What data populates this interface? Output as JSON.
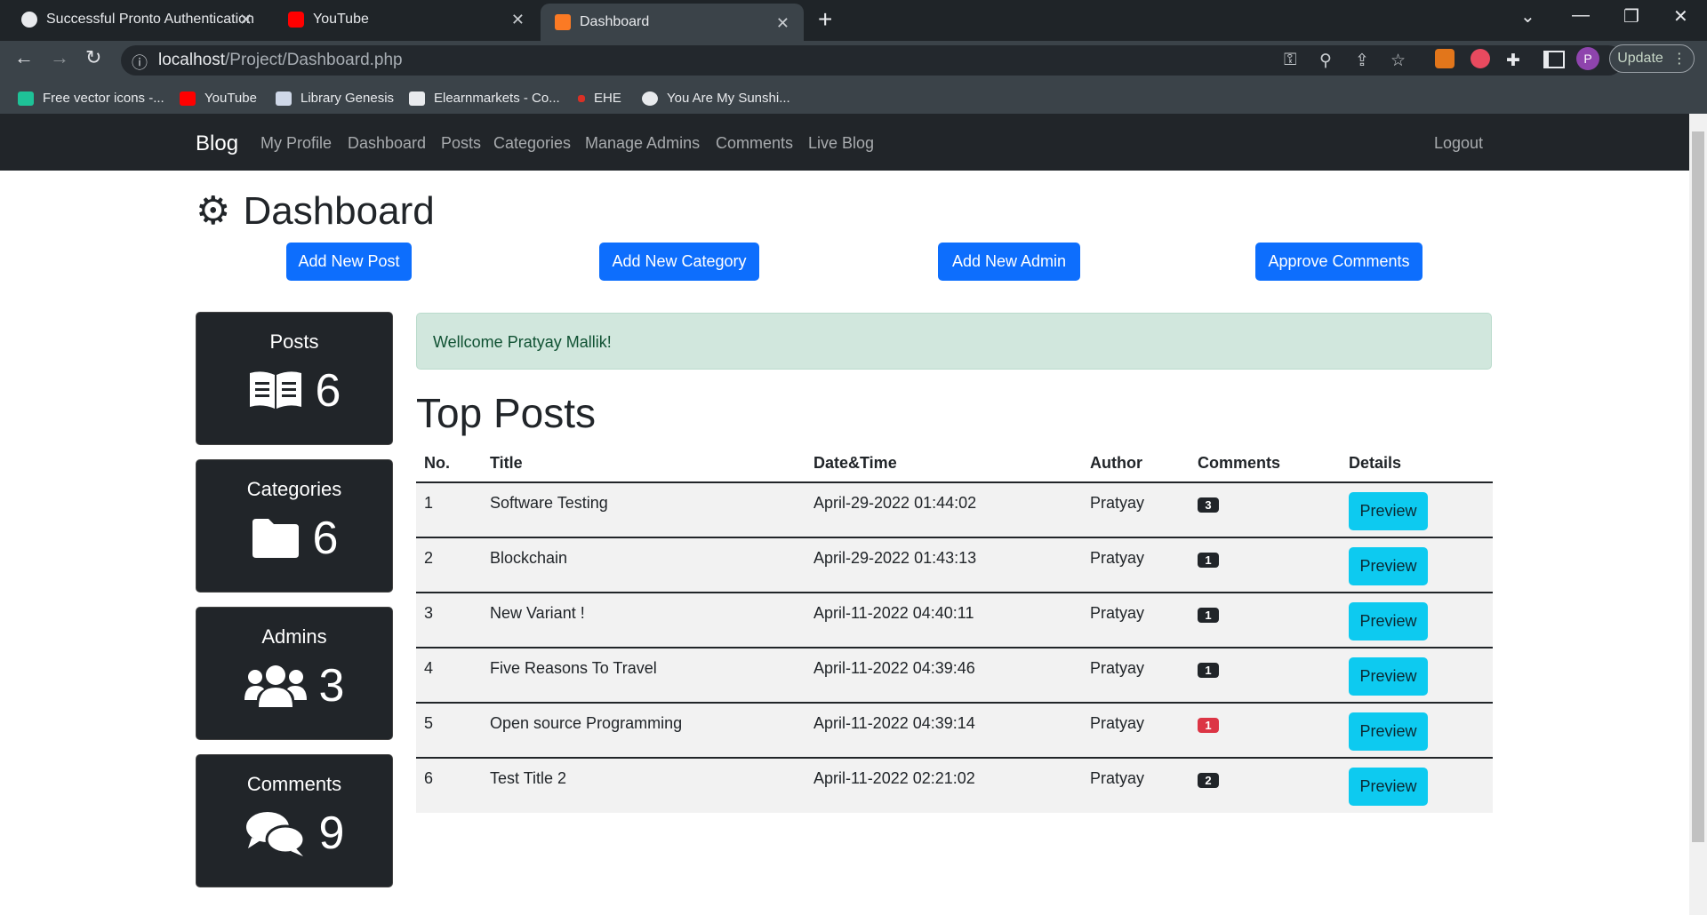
{
  "browser": {
    "tabs": [
      {
        "title": "Successful Pronto Authentication",
        "active": false
      },
      {
        "title": "YouTube",
        "active": false
      },
      {
        "title": "Dashboard",
        "active": true
      }
    ],
    "url_host": "localhost",
    "url_path": "/Project/Dashboard.php",
    "update_label": "Update",
    "profile_initial": "P",
    "bookmarks": [
      "Free vector icons -...",
      "YouTube",
      "Library Genesis",
      "Elearnmarkets - Co...",
      "EHE",
      "You Are My Sunshi..."
    ]
  },
  "navbar": {
    "brand": "Blog",
    "links": [
      "My Profile",
      "Dashboard",
      "Posts",
      "Categories",
      "Manage Admins",
      "Comments",
      "Live Blog"
    ],
    "logout": "Logout"
  },
  "page_title": "Dashboard",
  "actions": [
    "Add New Post",
    "Add New Category",
    "Add New Admin",
    "Approve Comments"
  ],
  "stats": [
    {
      "label": "Posts",
      "value": "6",
      "icon": "book-open-icon"
    },
    {
      "label": "Categories",
      "value": "6",
      "icon": "folder-icon"
    },
    {
      "label": "Admins",
      "value": "3",
      "icon": "users-icon"
    },
    {
      "label": "Comments",
      "value": "9",
      "icon": "comments-icon"
    }
  ],
  "welcome": "Wellcome Pratyay Mallik!",
  "top_posts": {
    "heading": "Top Posts",
    "columns": [
      "No.",
      "Title",
      "Date&Time",
      "Author",
      "Comments",
      "Details"
    ],
    "rows": [
      {
        "no": "1",
        "title": "Software Testing",
        "datetime": "April-29-2022 01:44:02",
        "author": "Pratyay",
        "comments": "3",
        "badge_color": "#212529",
        "details": "Preview"
      },
      {
        "no": "2",
        "title": "Blockchain",
        "datetime": "April-29-2022 01:43:13",
        "author": "Pratyay",
        "comments": "1",
        "badge_color": "#212529",
        "details": "Preview"
      },
      {
        "no": "3",
        "title": "New Variant !",
        "datetime": "April-11-2022 04:40:11",
        "author": "Pratyay",
        "comments": "1",
        "badge_color": "#212529",
        "details": "Preview"
      },
      {
        "no": "4",
        "title": "Five Reasons To Travel",
        "datetime": "April-11-2022 04:39:46",
        "author": "Pratyay",
        "comments": "1",
        "badge_color": "#212529",
        "details": "Preview"
      },
      {
        "no": "5",
        "title": "Open source Programming",
        "datetime": "April-11-2022 04:39:14",
        "author": "Pratyay",
        "comments": "1",
        "badge_color": "#dc3545",
        "details": "Preview"
      },
      {
        "no": "6",
        "title": "Test Title 2",
        "datetime": "April-11-2022 02:21:02",
        "author": "Pratyay",
        "comments": "2",
        "badge_color": "#212529",
        "details": "Preview"
      }
    ]
  }
}
